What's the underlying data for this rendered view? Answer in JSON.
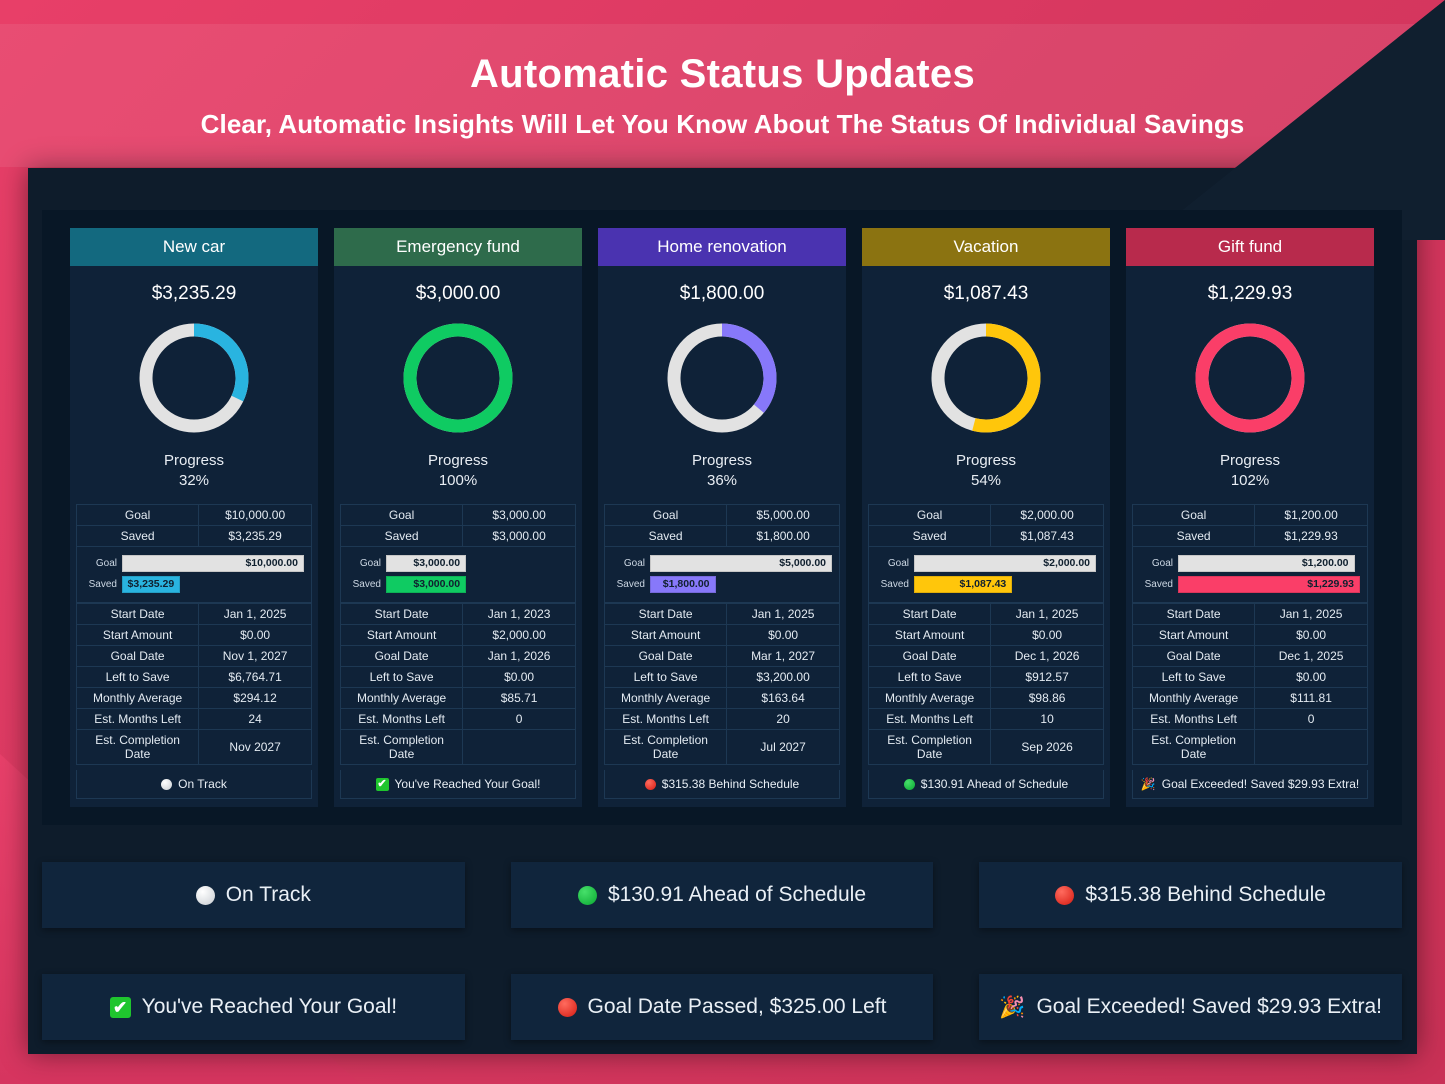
{
  "header": {
    "title": "Automatic Status Updates",
    "subtitle": "Clear, Automatic Insights Will Let You Know About The Status Of Individual Savings"
  },
  "labels": {
    "goal": "Goal",
    "saved": "Saved",
    "progress": "Progress",
    "start_date": "Start Date",
    "start_amount": "Start Amount",
    "goal_date": "Goal Date",
    "left_to_save": "Left to Save",
    "monthly_average": "Monthly Average",
    "est_months_left": "Est. Months Left",
    "est_completion_date": "Est. Completion Date"
  },
  "colors": {
    "new_car_header": "#13697f",
    "new_car_accent": "#29b4e0",
    "emergency_header": "#2e6b4b",
    "emergency_accent": "#0fcb62",
    "home_header": "#4a33b0",
    "home_accent": "#8778fa",
    "vacation_header": "#8b7311",
    "vacation_accent": "#ffc60b",
    "gift_header": "#b82a4c",
    "gift_accent": "#fa3e68",
    "track_grey": "#e2e2e2",
    "panel_bg": "#081726",
    "card_bg": "#0f2238",
    "banner_pink": "#e8406a"
  },
  "cards": [
    {
      "name": "New car",
      "header_color": "#13697f",
      "accent": "#29b4e0",
      "amount": "$3,235.29",
      "progress_percent": "32%",
      "progress_value": 32,
      "goal": "$10,000.00",
      "saved": "$3,235.29",
      "bar_goal_pct": 100,
      "bar_saved_pct": 32,
      "start_date": "Jan 1, 2025",
      "start_amount": "$0.00",
      "goal_date": "Nov 1, 2027",
      "left_to_save": "$6,764.71",
      "monthly_average": "$294.12",
      "est_months_left": "24",
      "est_completion_date": "Nov 2027",
      "status_text": "On Track",
      "status_icon": "grey-dot-icon"
    },
    {
      "name": "Emergency fund",
      "header_color": "#2e6b4b",
      "accent": "#0fcb62",
      "amount": "$3,000.00",
      "progress_percent": "100%",
      "progress_value": 100,
      "goal": "$3,000.00",
      "saved": "$3,000.00",
      "bar_goal_pct": 44,
      "bar_saved_pct": 44,
      "start_date": "Jan 1, 2023",
      "start_amount": "$2,000.00",
      "goal_date": "Jan 1, 2026",
      "left_to_save": "$0.00",
      "monthly_average": "$85.71",
      "est_months_left": "0",
      "est_completion_date": "",
      "status_text": "You've Reached Your Goal!",
      "status_icon": "check-box-icon"
    },
    {
      "name": "Home renovation",
      "header_color": "#4a33b0",
      "accent": "#8778fa",
      "amount": "$1,800.00",
      "progress_percent": "36%",
      "progress_value": 36,
      "goal": "$5,000.00",
      "saved": "$1,800.00",
      "bar_goal_pct": 100,
      "bar_saved_pct": 36,
      "start_date": "Jan 1, 2025",
      "start_amount": "$0.00",
      "goal_date": "Mar 1, 2027",
      "left_to_save": "$3,200.00",
      "monthly_average": "$163.64",
      "est_months_left": "20",
      "est_completion_date": "Jul 2027",
      "status_text": "$315.38 Behind Schedule",
      "status_icon": "red-dot-icon"
    },
    {
      "name": "Vacation",
      "header_color": "#8b7311",
      "accent": "#ffc60b",
      "amount": "$1,087.43",
      "progress_percent": "54%",
      "progress_value": 54,
      "goal": "$2,000.00",
      "saved": "$1,087.43",
      "bar_goal_pct": 100,
      "bar_saved_pct": 54,
      "start_date": "Jan 1, 2025",
      "start_amount": "$0.00",
      "goal_date": "Dec 1, 2026",
      "left_to_save": "$912.57",
      "monthly_average": "$98.86",
      "est_months_left": "10",
      "est_completion_date": "Sep 2026",
      "status_text": "$130.91 Ahead of Schedule",
      "status_icon": "green-dot-icon"
    },
    {
      "name": "Gift fund",
      "header_color": "#b82a4c",
      "accent": "#fa3e68",
      "amount": "$1,229.93",
      "progress_percent": "102%",
      "progress_value": 102,
      "goal": "$1,200.00",
      "saved": "$1,229.93",
      "bar_goal_pct": 97,
      "bar_saved_pct": 100,
      "start_date": "Jan 1, 2025",
      "start_amount": "$0.00",
      "goal_date": "Dec 1, 2025",
      "left_to_save": "$0.00",
      "monthly_average": "$111.81",
      "est_months_left": "0",
      "est_completion_date": "",
      "status_text": "Goal Exceeded! Saved $29.93 Extra!",
      "status_icon": "party-popper-icon"
    }
  ],
  "legend": [
    {
      "text": "On Track",
      "icon": "grey-dot-icon"
    },
    {
      "text": "$130.91 Ahead of Schedule",
      "icon": "green-dot-icon"
    },
    {
      "text": "$315.38 Behind Schedule",
      "icon": "red-dot-icon"
    },
    {
      "text": "You've Reached Your Goal!",
      "icon": "check-box-icon"
    },
    {
      "text": "Goal Date Passed, $325.00 Left",
      "icon": "red-dot-icon"
    },
    {
      "text": "Goal Exceeded! Saved $29.93 Extra!",
      "icon": "party-popper-icon"
    }
  ]
}
